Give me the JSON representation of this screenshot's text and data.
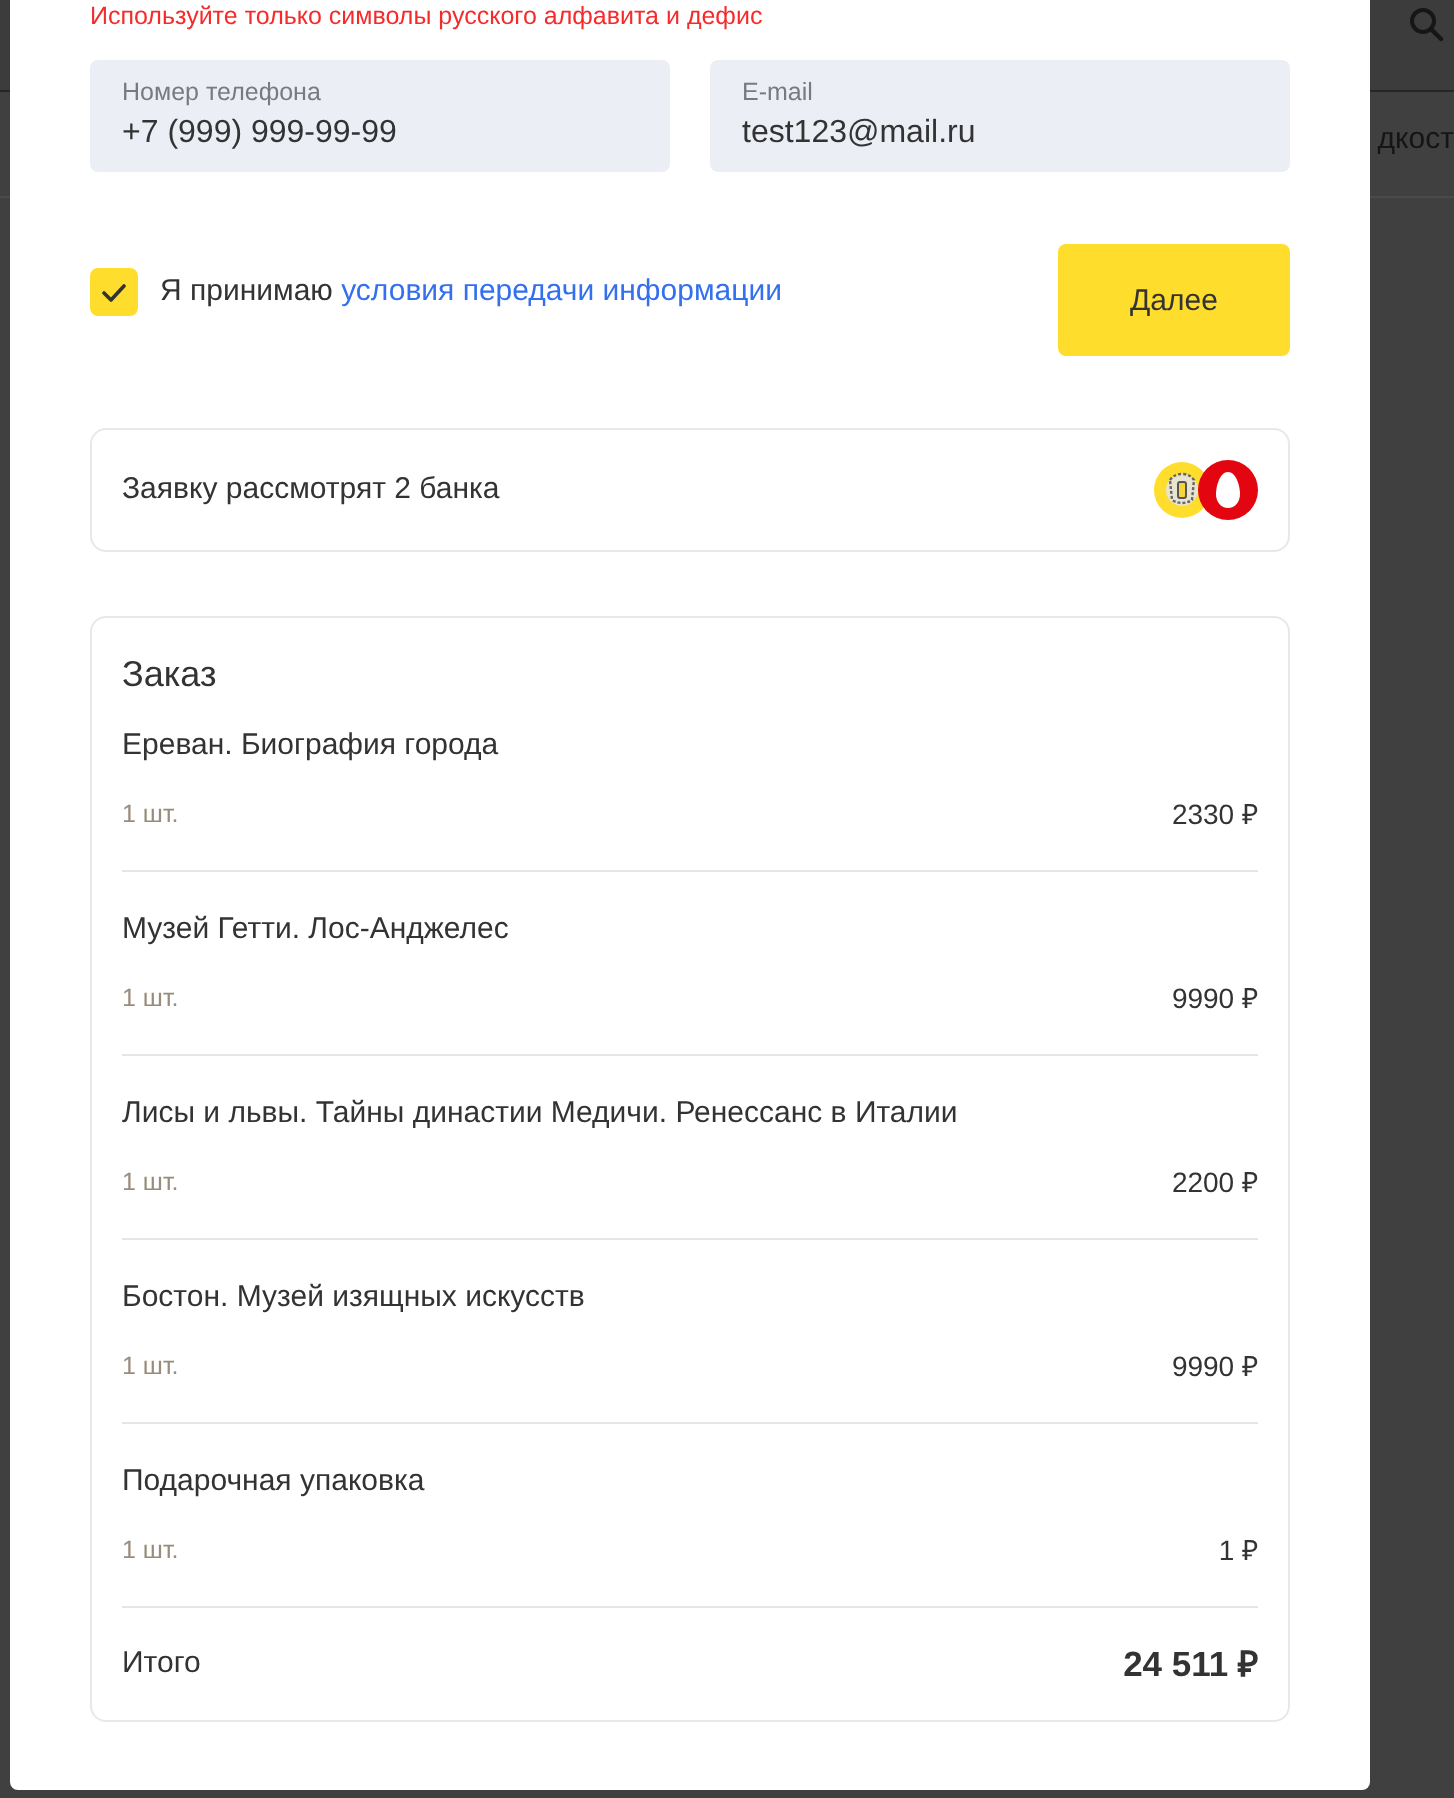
{
  "background": {
    "nav_text": "дкост"
  },
  "validation_message": "Используйте только символы русского алфавита и дефис",
  "contact_fields": [
    {
      "label": "Номер телефона",
      "value": "+7 (999) 999-99-99"
    },
    {
      "label": "E-mail",
      "value": "test123@mail.ru"
    }
  ],
  "consent": {
    "checked": true,
    "text": "Я принимаю",
    "link": "условия передачи информации"
  },
  "next_button": "Далее",
  "banks_note": "Заявку рассмотрят 2 банка",
  "order": {
    "title": "Заказ",
    "items": [
      {
        "name": "Ереван. Биография города",
        "quantity": "1 шт.",
        "price": "2330 ₽"
      },
      {
        "name": "Музей Гетти. Лос-Анджелес",
        "quantity": "1 шт.",
        "price": "9990 ₽"
      },
      {
        "name": "Лисы и львы. Тайны династии Медичи. Ренессанс в Италии",
        "quantity": "1 шт.",
        "price": "2200 ₽"
      },
      {
        "name": "Бостон. Музей изящных искусств",
        "quantity": "1 шт.",
        "price": "9990 ₽"
      },
      {
        "name": "Подарочная упаковка",
        "quantity": "1 шт.",
        "price": "1 ₽"
      }
    ],
    "total_label": "Итого",
    "total": "24 511 ₽"
  }
}
